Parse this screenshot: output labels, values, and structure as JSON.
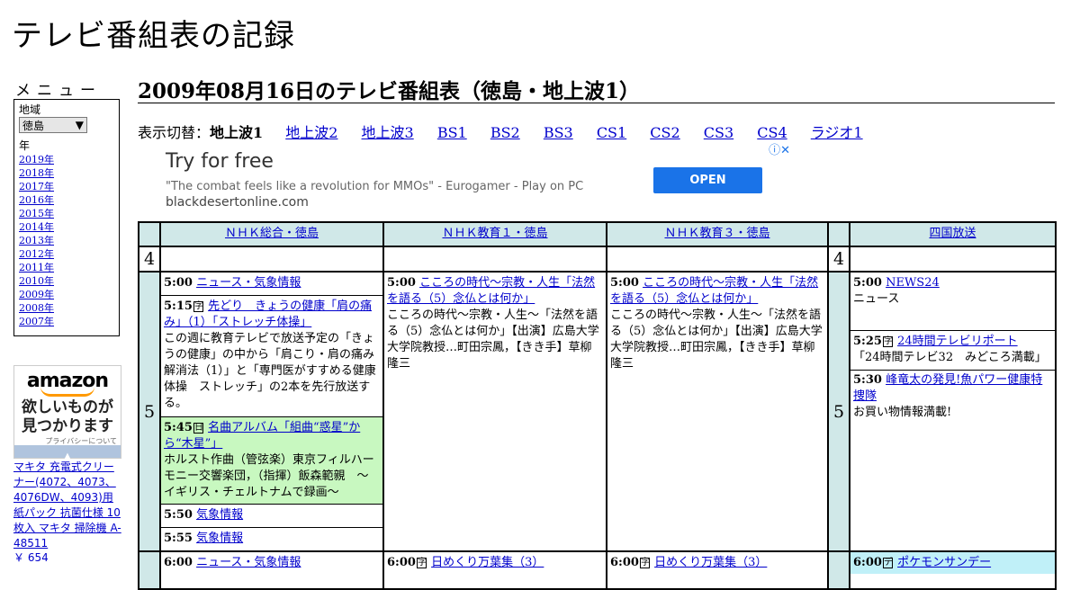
{
  "site": {
    "title": "テレビ番組表の記録"
  },
  "menu": {
    "label": "メニュー",
    "region_label": "地域",
    "region_value": "徳島",
    "year_label": "年",
    "years": [
      "2019年",
      "2018年",
      "2017年",
      "2016年",
      "2015年",
      "2014年",
      "2013年",
      "2012年",
      "2011年",
      "2010年",
      "2009年",
      "2008年",
      "2007年"
    ]
  },
  "amazon": {
    "logo": "amazon",
    "tagline_1": "欲しいものが",
    "tagline_2": "見つかります",
    "privacy": "プライバシーについて",
    "product": "マキタ 充電式クリーナー(4072、4073、4076DW、4093)用 紙パック 抗菌仕様 10枚入 マキタ 掃除機 A-48511",
    "price": "￥ 654"
  },
  "page": {
    "heading": "2009年08月16日のテレビ番組表（徳島・地上波1）"
  },
  "switcher": {
    "label": "表示切替：",
    "current": "地上波1",
    "links": [
      "地上波2",
      "地上波3",
      "BS1",
      "BS2",
      "BS3",
      "CS1",
      "CS2",
      "CS3",
      "CS4",
      "ラジオ1"
    ]
  },
  "ad": {
    "title": "Try for free",
    "quote": "\"The combat feels like a revolution for MMOs\" - Eurogamer - Play on PC",
    "domain": "blackdesertonline.com",
    "button": "OPEN",
    "info_icon": "info-icon",
    "close_icon": "close-icon"
  },
  "grid": {
    "channels": [
      "ＮＨＫ総合・徳島",
      "ＮＨＫ教育１・徳島",
      "ＮＨＫ教育３・徳島",
      "四国放送"
    ],
    "hour4": "4",
    "hour5": "5",
    "nhk_g": [
      {
        "time": "5:00",
        "title": "ニュース・気象情報",
        "desc": ""
      },
      {
        "time": "5:15",
        "mark": "字",
        "title": "先どり　きょうの健康「肩の痛み」（1）「ストレッチ体操」",
        "desc": "この週に教育テレビで放送予定の「きょうの健康」の中から「肩こり・肩の痛み解消法（1）」と「専門医がすすめる健康体操　ストレッチ」の2本を先行放送する。"
      },
      {
        "time": "5:45",
        "mark": "日",
        "title": "名曲アルバム「組曲“惑星”から“木星”」",
        "desc": "ホルスト作曲（管弦楽）東京フィルハーモニー交響楽団，（指揮）飯森範親　～イギリス・チェルトナムで録画～"
      },
      {
        "time": "5:50",
        "title": "気象情報",
        "desc": ""
      },
      {
        "time": "5:55",
        "title": "気象情報",
        "desc": ""
      },
      {
        "time": "6:00",
        "title": "ニュース・気象情報",
        "desc": ""
      }
    ],
    "nhk_e1": [
      {
        "time": "5:00",
        "title": "こころの時代～宗教・人生「法然を語る（5）念仏とは何か」",
        "desc": "こころの時代～宗教・人生～「法然を語る（5）念仏とは何か」【出演】広島大学大学院教授…町田宗鳳，【きき手】草柳隆三"
      },
      {
        "time": "6:00",
        "mark": "字",
        "title": "日めくり万葉集（3）",
        "desc": ""
      }
    ],
    "nhk_e3": [
      {
        "time": "5:00",
        "title": "こころの時代～宗教・人生「法然を語る（5）念仏とは何か」",
        "desc": "こころの時代～宗教・人生～「法然を語る（5）念仏とは何か」【出演】広島大学大学院教授…町田宗鳳，【きき手】草柳隆三"
      },
      {
        "time": "6:00",
        "mark": "字",
        "title": "日めくり万葉集（3）",
        "desc": ""
      }
    ],
    "jrt": [
      {
        "time": "5:00",
        "title": "NEWS24",
        "desc": "ニュース"
      },
      {
        "time": "5:25",
        "mark": "字",
        "title": "24時間テレビリポート",
        "desc": "「24時間テレビ32　みどころ満載」"
      },
      {
        "time": "5:30",
        "title": "峰竜太の発見!魚パワー健康特捜隊",
        "desc": "お買い物情報満載!"
      },
      {
        "time": "6:00",
        "mark": "デ",
        "title": "ポケモンサンデー",
        "desc": ""
      }
    ]
  }
}
